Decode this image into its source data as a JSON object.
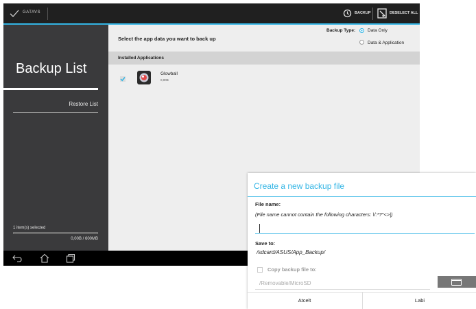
{
  "actionbar": {
    "title": "GATAVS",
    "backup_label": "BACKUP",
    "deselect_label": "DESELECT ALL"
  },
  "leftpane": {
    "title": "Backup List",
    "restore_label": "Restore List",
    "selected_text": "1 item(s) selected",
    "size_text": "0,00B / 600MB",
    "progress_fraction": 0
  },
  "rightpane": {
    "prompt": "Select the app data you want to back up",
    "backup_type_label": "Backup Type:",
    "options": [
      {
        "label": "Data Only",
        "selected": true
      },
      {
        "label": "Data & Application",
        "selected": false
      }
    ],
    "section_label": "Installed Applications",
    "apps": [
      {
        "name": "Glowball",
        "size": "0,00B",
        "checked": true
      }
    ]
  },
  "dialog": {
    "title": "Create a new backup file",
    "filename_label": "File name:",
    "filename_hint": "(File name cannot contain the following characters: \\/:*?\"<>|)",
    "filename_value": "",
    "saveto_label": "Save to:",
    "save_path": "/sdcard/ASUS/App_Backup/",
    "copy_label": "Copy backup file to:",
    "copy_checked": false,
    "copy_dest": "/Removable/MicroSD",
    "cancel_label": "Atcelt",
    "ok_label": "Labi"
  },
  "colors": {
    "accent": "#33b5e5",
    "sidebar": "#3a3a3c",
    "actionbar": "#202020"
  },
  "icons": {
    "check": "checkmark-icon",
    "backup": "backup-icon",
    "deselect": "deselect-icon",
    "back": "back-icon",
    "home": "home-icon",
    "recents": "recents-icon",
    "folder": "folder-icon"
  }
}
